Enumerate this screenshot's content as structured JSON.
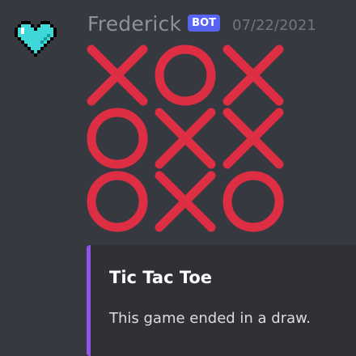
{
  "message": {
    "author": "Frederick",
    "badge": "BOT",
    "timestamp": "07/22/2021",
    "avatar_icon": "pixel-heart-icon",
    "avatar_color": "#3fd7d7"
  },
  "board": {
    "rows": [
      [
        "X",
        "O",
        "X"
      ],
      [
        "O",
        "X",
        "X"
      ],
      [
        "O",
        "X",
        "O"
      ]
    ],
    "mark_color": "#dd2e44"
  },
  "embed": {
    "title": "Tic Tac Toe",
    "description": "This game ended in a draw.",
    "accent_color": "#9152e8"
  }
}
